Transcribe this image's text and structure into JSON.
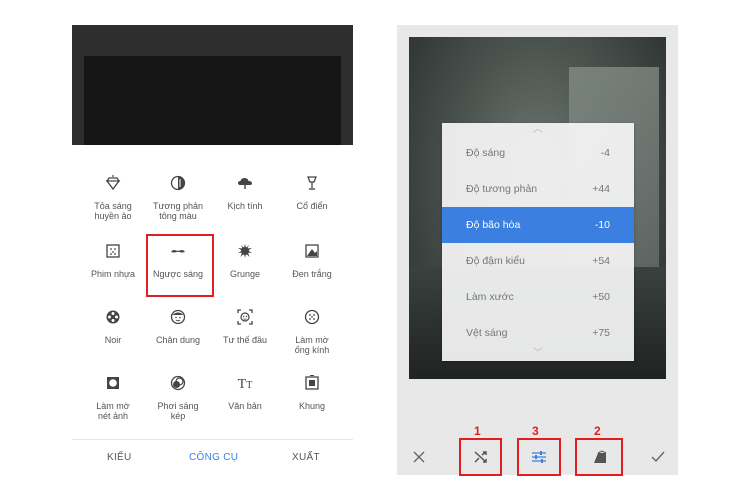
{
  "left_screen": {
    "tools": [
      {
        "label": "Tỏa sáng\nhuyền ảo",
        "icon": "diamond-glow-icon"
      },
      {
        "label": "Tương phản\ntông màu",
        "icon": "tonal-contrast-icon"
      },
      {
        "label": "Kịch tính",
        "icon": "cloud-drama-icon"
      },
      {
        "label": "Cổ điển",
        "icon": "lamp-vintage-icon"
      },
      {
        "label": "Phim nhựa",
        "icon": "film-grain-icon"
      },
      {
        "label": "Ngược sáng",
        "icon": "mustache-retrolux-icon"
      },
      {
        "label": "Grunge",
        "icon": "grunge-splat-icon"
      },
      {
        "label": "Đen trắng",
        "icon": "black-white-icon"
      },
      {
        "label": "Noir",
        "icon": "film-reel-icon"
      },
      {
        "label": "Chân dung",
        "icon": "face-portrait-icon"
      },
      {
        "label": "Tư thế đầu",
        "icon": "face-pose-icon"
      },
      {
        "label": "Làm mờ\nống kính",
        "icon": "lens-blur-icon"
      },
      {
        "label": "Làm mờ\nnét ảnh",
        "icon": "vignette-icon"
      },
      {
        "label": "Phơi sáng\nkép",
        "icon": "double-exposure-icon"
      },
      {
        "label": "Văn bản",
        "icon": "text-icon"
      },
      {
        "label": "Khung",
        "icon": "frame-icon"
      }
    ],
    "selected_tool": "Ngược sáng",
    "tabs": {
      "styles": "KIỂU",
      "tools": "CÔNG CỤ",
      "export": "XUẤT"
    },
    "active_tab_color": "#3b7fe0"
  },
  "right_screen": {
    "adjustments": [
      {
        "name": "Độ sáng",
        "value": "-4"
      },
      {
        "name": "Độ tương phản",
        "value": "+44"
      },
      {
        "name": "Độ bão hòa",
        "value": "-10"
      },
      {
        "name": "Độ đậm kiểu",
        "value": "+54"
      },
      {
        "name": "Làm xước",
        "value": "+50"
      },
      {
        "name": "Vệt sáng",
        "value": "+75"
      }
    ],
    "active_adjustment": "Độ bão hòa",
    "highlight_color": "#3b7fe0",
    "toolbar": {
      "cancel_icon": "close-icon",
      "shuffle_icon": "shuffle-icon",
      "adjust_icon": "sliders-icon",
      "style_icon": "style-brush-icon",
      "apply_icon": "check-icon"
    },
    "annotations": {
      "shuffle": "1",
      "adjust": "3",
      "style": "2"
    }
  }
}
